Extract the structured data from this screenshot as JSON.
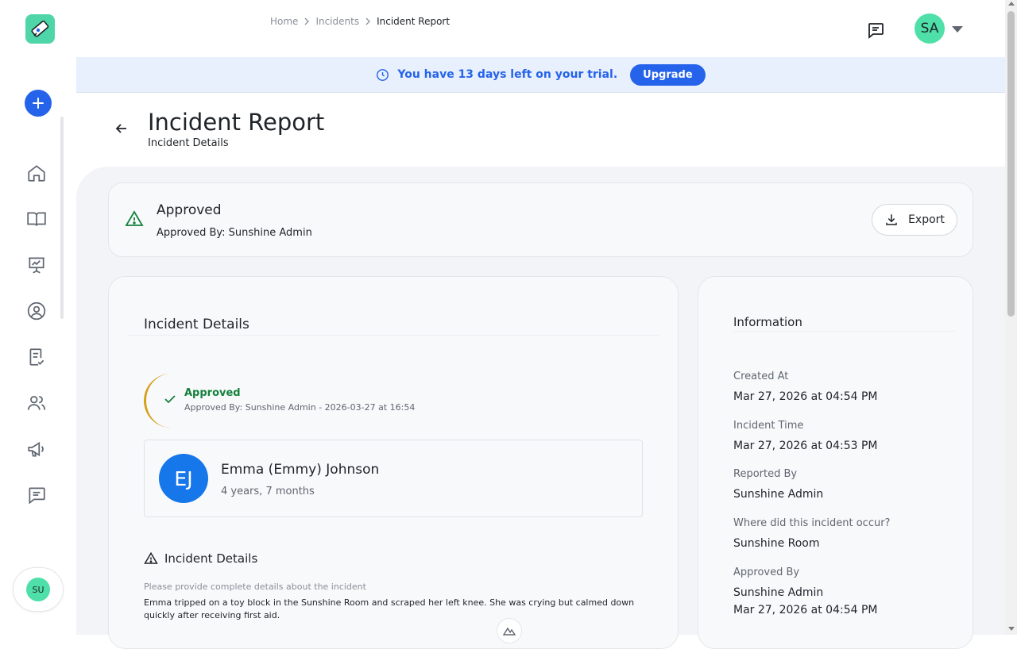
{
  "breadcrumb": {
    "home": "Home",
    "incidents": "Incidents",
    "current": "Incident Report"
  },
  "header": {
    "avatar_initials": "SA"
  },
  "trial": {
    "message": "You have 13 days left on your trial.",
    "upgrade_label": "Upgrade"
  },
  "page": {
    "title": "Incident Report",
    "subtitle": "Incident Details"
  },
  "status": {
    "title": "Approved",
    "approved_by": "Approved By: Sunshine Admin",
    "export_label": "Export"
  },
  "details": {
    "title": "Incident Details",
    "approval": {
      "status": "Approved",
      "meta": "Approved By: Sunshine Admin - 2026-03-27 at 16:54"
    },
    "child": {
      "initials": "EJ",
      "name": "Emma (Emmy) Johnson",
      "age": "4 years, 7 months"
    },
    "section_title": "Incident Details",
    "question": "Please provide complete details about the incident",
    "answer": "Emma tripped on a toy block in the Sunshine Room and scraped her left knee. She was crying but calmed down quickly after receiving first aid."
  },
  "information": {
    "title": "Information",
    "fields": [
      {
        "label": "Created At",
        "value": "Mar 27, 2026 at 04:54 PM"
      },
      {
        "label": "Incident Time",
        "value": "Mar 27, 2026 at 04:53 PM"
      },
      {
        "label": "Reported By",
        "value": "Sunshine Admin"
      },
      {
        "label": "Where did this incident occur?",
        "value": "Sunshine Room"
      },
      {
        "label": "Approved By",
        "value": "Sunshine Admin",
        "value2": "Mar 27, 2026 at 04:54 PM"
      }
    ]
  },
  "sidebar": {
    "user_initials": "SU",
    "icons": [
      "home-icon",
      "book-icon",
      "presentation-icon",
      "profile-icon",
      "checklist-icon",
      "users-icon",
      "megaphone-icon",
      "message-icon"
    ]
  },
  "colors": {
    "primary": "#2563eb",
    "success": "#15803d",
    "accent_gold": "#d4a017",
    "avatar_green": "#4ee0a8",
    "child_avatar": "#1677ea"
  }
}
